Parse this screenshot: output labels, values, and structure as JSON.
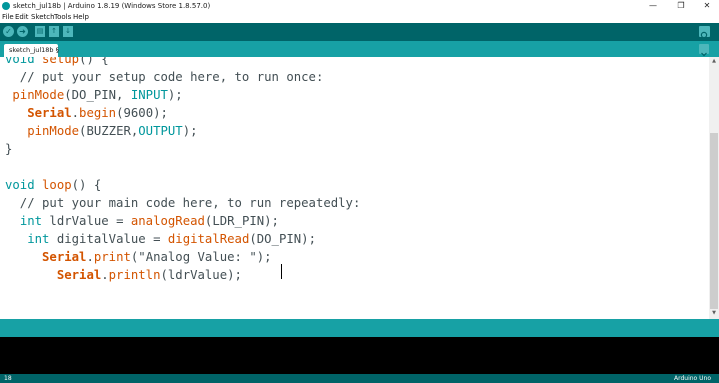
{
  "window": {
    "title": "sketch_jul18b | Arduino 1.8.19 (Windows Store 1.8.57.0)",
    "controls": {
      "minimize": "—",
      "maximize": "❐",
      "close": "✕"
    }
  },
  "menu": [
    "File",
    "Edit",
    "Sketch",
    "Tools",
    "Help"
  ],
  "toolbar": {
    "verify": "✓",
    "upload": "➜",
    "new": "▤",
    "open": "↑",
    "save": "↓"
  },
  "tab": {
    "label": "sketch_jul18b §"
  },
  "code_lines": [
    {
      "segments": [
        [
          "void ",
          "ty"
        ],
        [
          "setup",
          "kw"
        ],
        [
          "() {",
          ""
        ]
      ]
    },
    {
      "segments": [
        [
          "  // put your setup code here, to run once:",
          "cm"
        ]
      ]
    },
    {
      "segments": [
        [
          " ",
          ""
        ],
        [
          "pinMode",
          "kw"
        ],
        [
          "(DO_PIN, ",
          ""
        ],
        [
          "INPUT",
          "ty"
        ],
        [
          ");",
          ""
        ]
      ]
    },
    {
      "segments": [
        [
          "   ",
          ""
        ],
        [
          "Serial",
          "kwb"
        ],
        [
          ".",
          ""
        ],
        [
          "begin",
          "kw"
        ],
        [
          "(9600);",
          ""
        ]
      ]
    },
    {
      "segments": [
        [
          "   ",
          ""
        ],
        [
          "pinMode",
          "kw"
        ],
        [
          "(BUZZER,",
          ""
        ],
        [
          "OUTPUT",
          "ty"
        ],
        [
          ");",
          ""
        ]
      ]
    },
    {
      "segments": [
        [
          "}",
          ""
        ]
      ]
    },
    {
      "segments": [
        [
          "",
          ""
        ]
      ]
    },
    {
      "segments": [
        [
          "void ",
          "ty"
        ],
        [
          "loop",
          "kw"
        ],
        [
          "() {",
          ""
        ]
      ]
    },
    {
      "segments": [
        [
          "  // put your main code here, to run repeatedly:",
          "cm"
        ]
      ]
    },
    {
      "segments": [
        [
          "  ",
          ""
        ],
        [
          "int",
          "ty"
        ],
        [
          " ldrValue = ",
          ""
        ],
        [
          "analogRead",
          "kw"
        ],
        [
          "(LDR_PIN);",
          ""
        ]
      ]
    },
    {
      "segments": [
        [
          "   ",
          ""
        ],
        [
          "int",
          "ty"
        ],
        [
          " digitalValue = ",
          ""
        ],
        [
          "digitalRead",
          "kw"
        ],
        [
          "(DO_PIN);",
          ""
        ]
      ]
    },
    {
      "segments": [
        [
          "     ",
          ""
        ],
        [
          "Serial",
          "kwb"
        ],
        [
          ".",
          ""
        ],
        [
          "print",
          "kw"
        ],
        [
          "(\"Analog Value: \");",
          ""
        ]
      ]
    },
    {
      "segments": [
        [
          "       ",
          ""
        ],
        [
          "Serial",
          "kwb"
        ],
        [
          ".",
          ""
        ],
        [
          "println",
          "kw"
        ],
        [
          "(ldrValue);",
          ""
        ]
      ]
    },
    {
      "segments": [
        [
          "",
          ""
        ]
      ]
    },
    {
      "segments": [
        [
          "",
          ""
        ]
      ]
    },
    {
      "segments": [
        [
          "}",
          ""
        ]
      ]
    }
  ],
  "status": {
    "line_number": "18",
    "board": "Arduino Uno"
  },
  "colors": {
    "toolbar": "#006468",
    "tabbar": "#17a1a5",
    "keyword": "#d35400",
    "type": "#00979c"
  }
}
